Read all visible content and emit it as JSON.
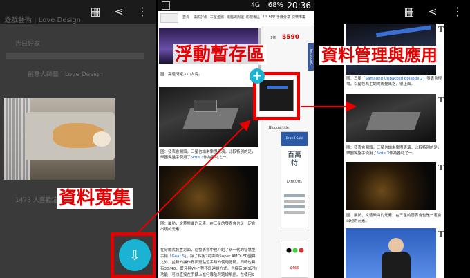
{
  "overlay": {
    "label_stash": "浮動暫存區",
    "label_manage": "資料管理與應用",
    "label_collect": "資料蒐集",
    "accent_color": "#e60000",
    "fab_color": "#1bb3d3"
  },
  "left_phone": {
    "toolbar": {
      "icons": [
        "grid-icon",
        "share-icon",
        "more-icon"
      ]
    },
    "faded_title": "遊戲藝術 | Love Design",
    "faded_row_1": "吉日好家",
    "faded_row_2": "創意大師藝 | Love Design",
    "faded_row_3": "1478 人喜歡這個粉絲專頁"
  },
  "middle_phone": {
    "status": {
      "network": "4G",
      "battery": "68%",
      "clock": "20:36"
    },
    "nav_items": [
      "首頁",
      "攝影評測",
      "三星金融",
      "電腦與周邊",
      "影視專區",
      "Tis App",
      "手機分享",
      "快樂市集",
      "數位單眼"
    ],
    "price_prefix": "1條",
    "price": "$590",
    "facebook_tab": "facebook",
    "caption_1": "圖：亮燈閃耀入山人海。",
    "caption_2_a": "圖：發表會開頭，三星也請來樂團表演，比較特別的是，樂團鍵盤手使用了",
    "caption_2_hl": "Note 3",
    "caption_2_b": "作為器材之一。",
    "caption_3": "圖：屬熱，文藝樂曲的元素，在三星的發表會也是一定會出現的元素。",
    "para": "在穿戴式裝置方面，在發表會中也介紹了新一代的智慧型手錶「",
    "para_hl": "Gear S",
    "para_b": "」，除了採用2吋曲面Super AMOLED螢幕之外，並新的操作界面更貼近手錶的使用體驗，同時也具有3G/4G、藍牙與Wi-Fi等不同連線方式，也擁有GPS定位功能，可以直接在手錶上進行導航與路線規劃。在使用S",
    "sidebar_label_1": "Bloggertide",
    "ad_top": "Brand Sale",
    "ad_chars": "百萬特",
    "ad_brand": "LANCÔME",
    "ad2_price": "$466"
  },
  "right_phone": {
    "toolbar": {
      "icons": [
        "grid-icon",
        "share-icon",
        "more-icon"
      ]
    },
    "card_badge": "T",
    "cap_1_a": "圖：三星",
    "cap_1_hl": "「Samsung Unpacked Episode 2」",
    "cap_1_b": "發表會現場，以藍色為主調的視覺風格，很正面。",
    "cap_2_a": "圖：發表會開頭，三星也請來樂團表演，比較特別的是，樂團鍵盤手使用了",
    "cap_2_hl": "Note 3",
    "cap_2_b": "作為器材之一。",
    "cap_3": "圖：屬熱，文藝樂曲的元素，在三星的發表會也是一定會出現的元素。"
  }
}
